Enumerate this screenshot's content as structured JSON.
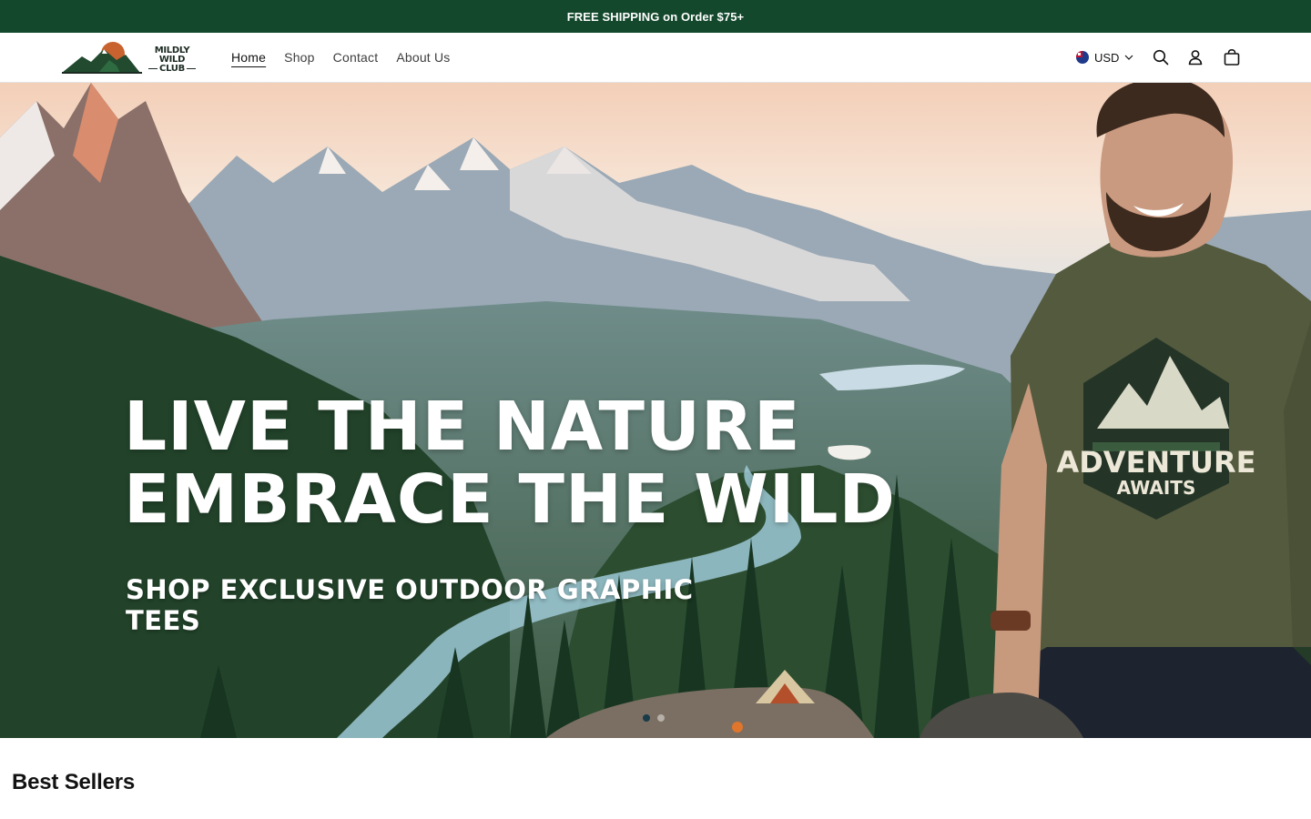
{
  "announcement": {
    "text": "FREE SHIPPING on Order $75+"
  },
  "brand": {
    "line1": "MILDLY WILD",
    "line2": "CLUB"
  },
  "nav": {
    "items": [
      {
        "label": "Home",
        "active": true
      },
      {
        "label": "Shop",
        "active": false
      },
      {
        "label": "Contact",
        "active": false
      },
      {
        "label": "About Us",
        "active": false
      }
    ]
  },
  "header_tools": {
    "currency": "USD",
    "icons": [
      "search-icon",
      "account-icon",
      "cart-icon"
    ]
  },
  "hero": {
    "title_line1": "LIVE THE NATURE",
    "title_line2": "EMBRACE THE WILD",
    "subtitle": "SHOP EXCLUSIVE OUTDOOR GRAPHIC TEES",
    "shirt_line1": "ADVENTURE",
    "shirt_line2": "AWAITS",
    "slides": 2,
    "active_slide": 1
  },
  "sections": {
    "best_sellers": "Best Sellers"
  },
  "colors": {
    "announcement_bg": "#14482c",
    "text": "#121212",
    "shirt": "#545a3e"
  }
}
